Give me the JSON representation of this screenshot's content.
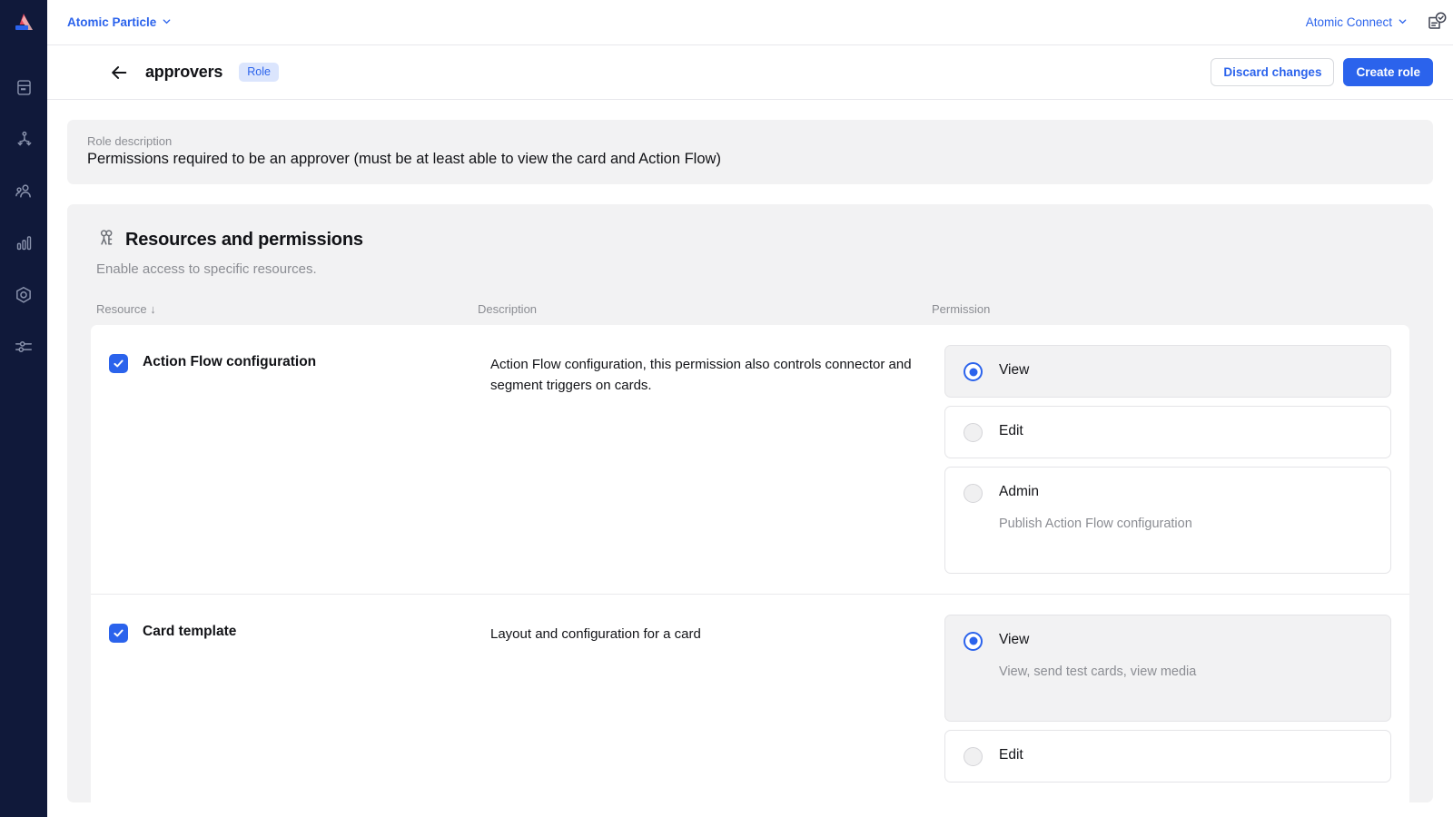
{
  "sidebar": {
    "logo_name": "atomic-logo",
    "items": [
      {
        "icon": "cards-icon",
        "name": "sidebar-item-cards"
      },
      {
        "icon": "action-flow-icon",
        "name": "sidebar-item-action-flow"
      },
      {
        "icon": "customers-icon",
        "name": "sidebar-item-customers"
      },
      {
        "icon": "analytics-icon",
        "name": "sidebar-item-analytics"
      },
      {
        "icon": "settings-icon",
        "name": "sidebar-item-settings"
      },
      {
        "icon": "sliders-icon",
        "name": "sidebar-item-configuration"
      }
    ]
  },
  "topbar": {
    "org_name": "Atomic Particle",
    "connect_name": "Atomic Connect",
    "doc_icon": "document-check-icon"
  },
  "header": {
    "back_icon": "back-arrow-icon",
    "title": "approvers",
    "badge": "Role",
    "discard_label": "Discard changes",
    "create_label": "Create role"
  },
  "role_description": {
    "label": "Role description",
    "value": "Permissions required to be an approver (must be at least able to view the card and Action Flow)"
  },
  "resources_panel": {
    "icon": "people-group-icon",
    "title": "Resources and permissions",
    "subtitle": "Enable access to specific resources.",
    "columns": {
      "resource": "Resource",
      "resource_sort": "↓",
      "description": "Description",
      "permission": "Permission"
    },
    "rows": [
      {
        "checked": true,
        "name": "Action Flow configuration",
        "description": "Action Flow configuration, this permission also controls connector and segment triggers on cards.",
        "permissions": [
          {
            "label": "View",
            "description": "",
            "selected": true
          },
          {
            "label": "Edit",
            "description": "",
            "selected": false
          },
          {
            "label": "Admin",
            "description": "Publish Action Flow configuration",
            "selected": false
          }
        ]
      },
      {
        "checked": true,
        "name": "Card template",
        "description": "Layout and configuration for a card",
        "permissions": [
          {
            "label": "View",
            "description": "View, send test cards, view media",
            "selected": true
          },
          {
            "label": "Edit",
            "description": "",
            "selected": false
          }
        ]
      }
    ]
  },
  "colors": {
    "accent": "#2b63ec",
    "sidebar_bg": "#10193a",
    "panel_bg": "#f2f2f3",
    "muted_text": "#8b8d93"
  }
}
